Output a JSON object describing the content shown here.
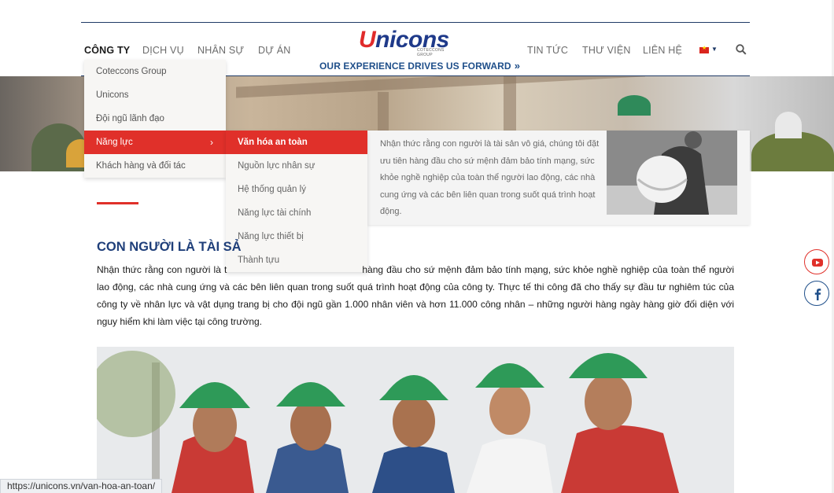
{
  "header": {
    "nav_left": [
      "CÔNG TY",
      "DỊCH VỤ",
      "NHÂN SỰ",
      "DỰ ÁN"
    ],
    "nav_right": [
      "TIN TỨC",
      "THƯ VIỆN",
      "LIÊN HỆ"
    ],
    "logo_text": "Unicons",
    "logo_sub": "COTECCONS GROUP",
    "tagline": "OUR EXPERIENCE DRIVES US FORWARD",
    "tagline_arrow": "»"
  },
  "dropdown": {
    "items": [
      "Coteccons Group",
      "Unicons",
      "Đội ngũ lãnh đạo",
      "Năng lực",
      "Khách hàng và đối tác"
    ],
    "chevron": "›"
  },
  "submenu": {
    "items": [
      "Văn hóa an toàn",
      "Nguồn lực nhân sự",
      "Hệ thống quản lý",
      "Năng lực tài chính",
      "Năng lực thiết bị",
      "Thành tựu"
    ]
  },
  "preview": {
    "text": "Nhận thức rằng con người là tài sản vô giá, chúng tôi đặt ưu tiên hàng đầu cho sứ mệnh đảm bảo tính mạng, sức khỏe nghề nghiệp của toàn thể người lao động, các nhà cung ứng và các bên liên quan trong suốt quá trình hoạt động."
  },
  "article": {
    "heading": "CON NGƯỜI LÀ TÀI SẢ",
    "para_start": "Nhận thức rằng con người là t",
    "para_rest": "hàng đầu cho sứ mệnh đảm bảo tính mạng, sức khỏe nghề nghiệp của toàn thể người lao động, các nhà cung ứng và các bên liên quan trong suốt quá trình hoạt động của công ty. Thực tế thi công đã cho thấy sự đầu tư nghiêm túc của công ty về nhân lực và vật dụng trang bị cho đội ngũ gần 1.000 nhân viên và hơn 11.000 công nhân – những người hàng ngày hàng giờ đối diện với nguy hiểm khi làm việc tại công trường."
  },
  "social": {
    "youtube_icon": "youtube-icon",
    "facebook_icon": "facebook-icon"
  },
  "status_bar": {
    "url": "https://unicons.vn/van-hoa-an-toan/"
  },
  "colors": {
    "brand_blue": "#1f3a8a",
    "accent_red": "#e0302a",
    "heading_blue": "#1f3f7a"
  }
}
